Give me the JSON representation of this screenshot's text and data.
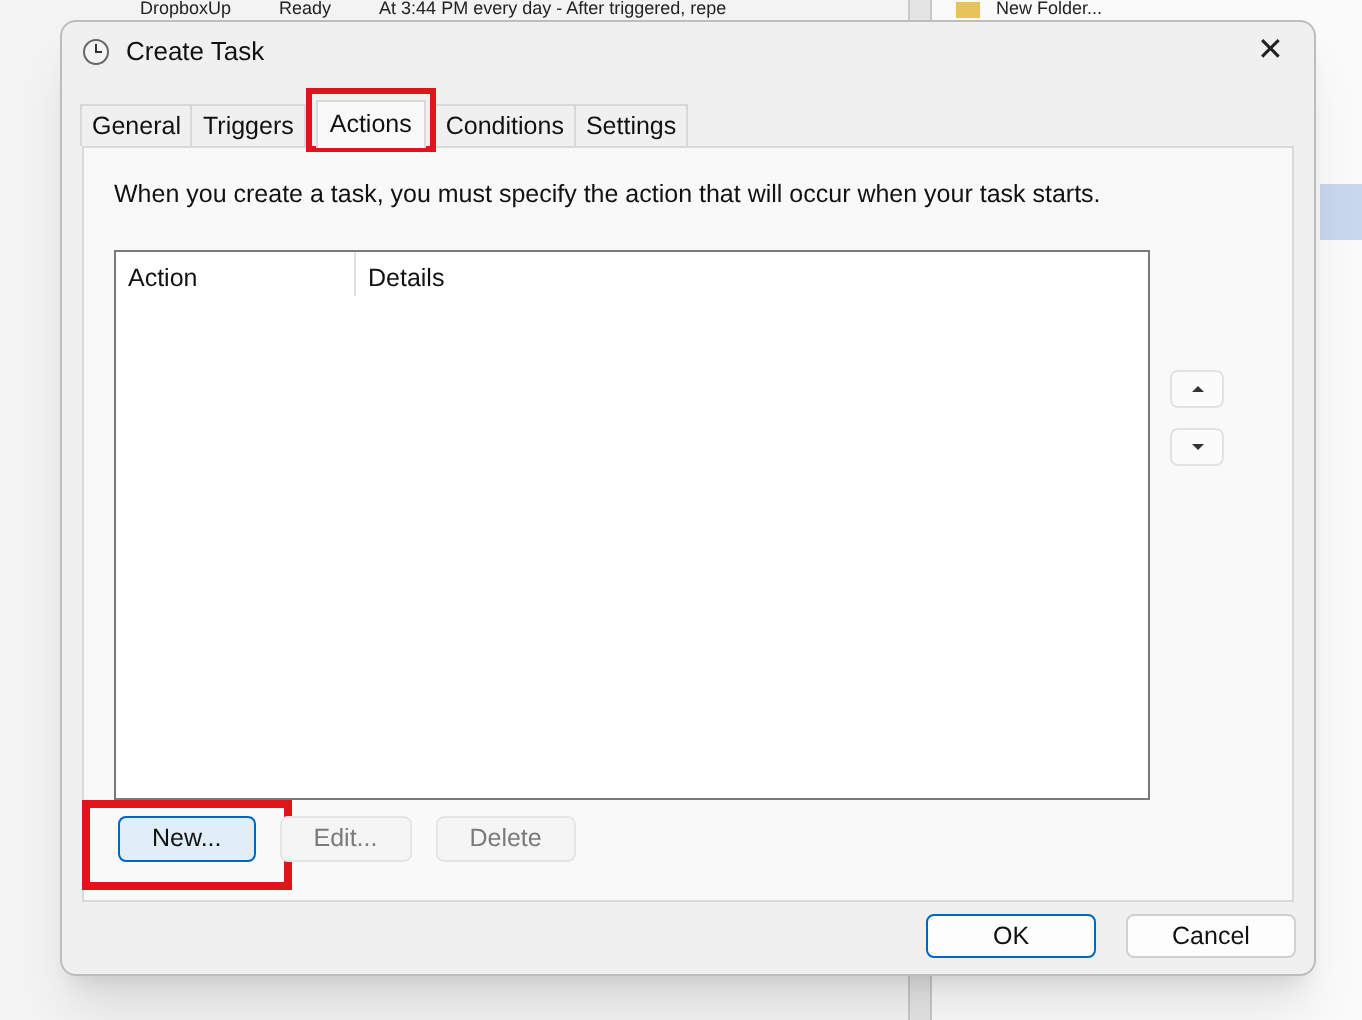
{
  "background_window": {
    "row": [
      "DropboxUp",
      "Ready",
      "At 3:44 PM every day - After triggered, repe"
    ],
    "side_item": "New Folder..."
  },
  "window": {
    "title": "Create Task",
    "close": "✕"
  },
  "tabs": [
    {
      "label": "General",
      "selected": false,
      "highlighted": false
    },
    {
      "label": "Triggers",
      "selected": false,
      "highlighted": false
    },
    {
      "label": "Actions",
      "selected": true,
      "highlighted": true
    },
    {
      "label": "Conditions",
      "selected": false,
      "highlighted": false
    },
    {
      "label": "Settings",
      "selected": false,
      "highlighted": false
    }
  ],
  "description": "When you create a task, you must specify the action that will occur when your task starts.",
  "table": {
    "columns": [
      "Action",
      "Details"
    ]
  },
  "move_buttons": [
    {
      "kind": "up"
    },
    {
      "kind": "down"
    }
  ],
  "action_buttons": [
    {
      "label": "New...",
      "disabled": false,
      "highlighted": true
    },
    {
      "label": "Edit...",
      "disabled": true,
      "highlighted": false
    },
    {
      "label": "Delete",
      "disabled": true,
      "highlighted": false
    }
  ],
  "dialog_buttons": [
    {
      "label": "OK",
      "default": true
    },
    {
      "label": "Cancel",
      "default": false
    }
  ]
}
